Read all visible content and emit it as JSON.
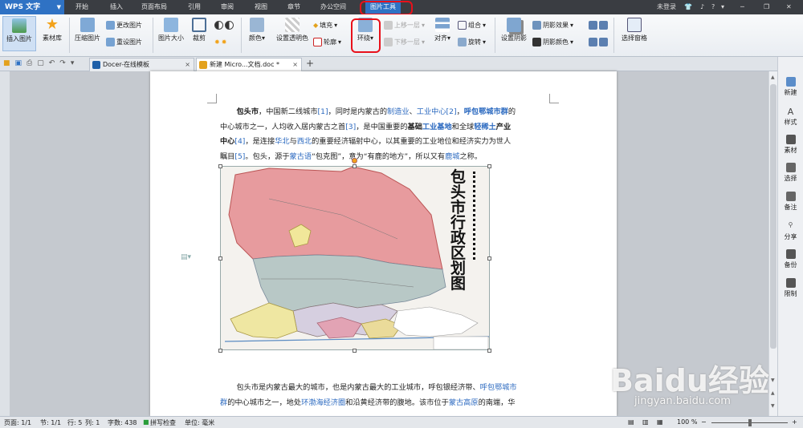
{
  "app": {
    "name": "WPS 文字"
  },
  "menu": {
    "tabs": [
      "开始",
      "插入",
      "页面布局",
      "引用",
      "审阅",
      "视图",
      "章节",
      "办公空间",
      "图片工具"
    ],
    "active": "图片工具",
    "right": {
      "login": "未登录",
      "help": "?"
    }
  },
  "ribbon": {
    "insert_picture": "插入图片",
    "material": "素材库",
    "compress": "压缩图片",
    "change_picture": "更改图片",
    "reset_picture": "重设图片",
    "picture_size": "图片大小",
    "crop": "裁剪",
    "color": "颜色",
    "transparent": "设置透明色",
    "fill": "填充",
    "outline": "轮廓",
    "wrap": "环绕",
    "bring_forward": "上移一层",
    "send_backward": "下移一层",
    "align": "对齐",
    "combine": "组合",
    "rotate": "旋转",
    "set_shadow": "设置阴影",
    "shadow_effect": "阴影效果",
    "shadow_color": "阴影颜色",
    "selection_pane": "选择窗格"
  },
  "tabs": [
    {
      "label": "Docer-在线模板",
      "close": "×"
    },
    {
      "label": "新建 Micro...文档.doc *",
      "close": "×"
    }
  ],
  "tab_add": "+",
  "document": {
    "p1": {
      "l1a": "包头市",
      "l1b": "，中国新二线城市",
      "l1c": "[1]",
      "l1d": "，同时是内蒙古的",
      "l1e": "制造业",
      "l1f": "、",
      "l1g": "工业中心",
      "l1h": "[2]",
      "l1i": "，",
      "l1j": "呼包鄂城市群",
      "l1k": "的",
      "l2a": "中心城市之一，人均收入居内蒙古之首",
      "l2b": "[3]",
      "l2c": "，是中国重要的",
      "l2d": "基础",
      "l2e": "工业基地",
      "l2f": "和全球",
      "l2g": "轻稀土",
      "l2h": "产业",
      "l3a": "中心",
      "l3b": "[4]",
      "l3c": "，是连接",
      "l3d": "华北",
      "l3e": "与",
      "l3f": "西北",
      "l3g": "的重要经济辐射中心，以其重要的工业地位和经济实力为世人",
      "l4a": "瞩目",
      "l4b": "[5]",
      "l4c": "。包头，源于",
      "l4d": "蒙古语",
      "l4e": "“包克图”，意为“有鹿的地方”，所以又有",
      "l4f": "鹿城",
      "l4g": "之称。"
    },
    "map_title": "包头市行政区划图",
    "p2": {
      "l1a": "包头市是内蒙古最大的城市，也是内蒙古最大的工业城市，呼包银经济带、",
      "l1b": "呼包鄂城市",
      "l2a": "群",
      "l2b": "的中心城市之一，地处",
      "l2c": "环渤海经济圈",
      "l2d": "和沿黄经济带的腹地。该市位于",
      "l2e": "蒙古高原",
      "l2f": "的南端，华"
    }
  },
  "sidebar": [
    "新建",
    "样式",
    "素材",
    "选择",
    "备注",
    "分享",
    "备份",
    "限制"
  ],
  "status": {
    "page": "页面: 1/1",
    "section": "节: 1/1",
    "row": "行: 5",
    "col": "列: 1",
    "words": "字数: 438",
    "spell": "拼写检查",
    "unit": "单位: 毫米",
    "zoom": "100 %"
  },
  "watermark": {
    "brand": "Baidu经验",
    "url": "jingyan.baidu.com"
  },
  "colors": {
    "accent": "#2f72c4",
    "highlight": "#e8111b",
    "link": "#2c6ac0"
  }
}
